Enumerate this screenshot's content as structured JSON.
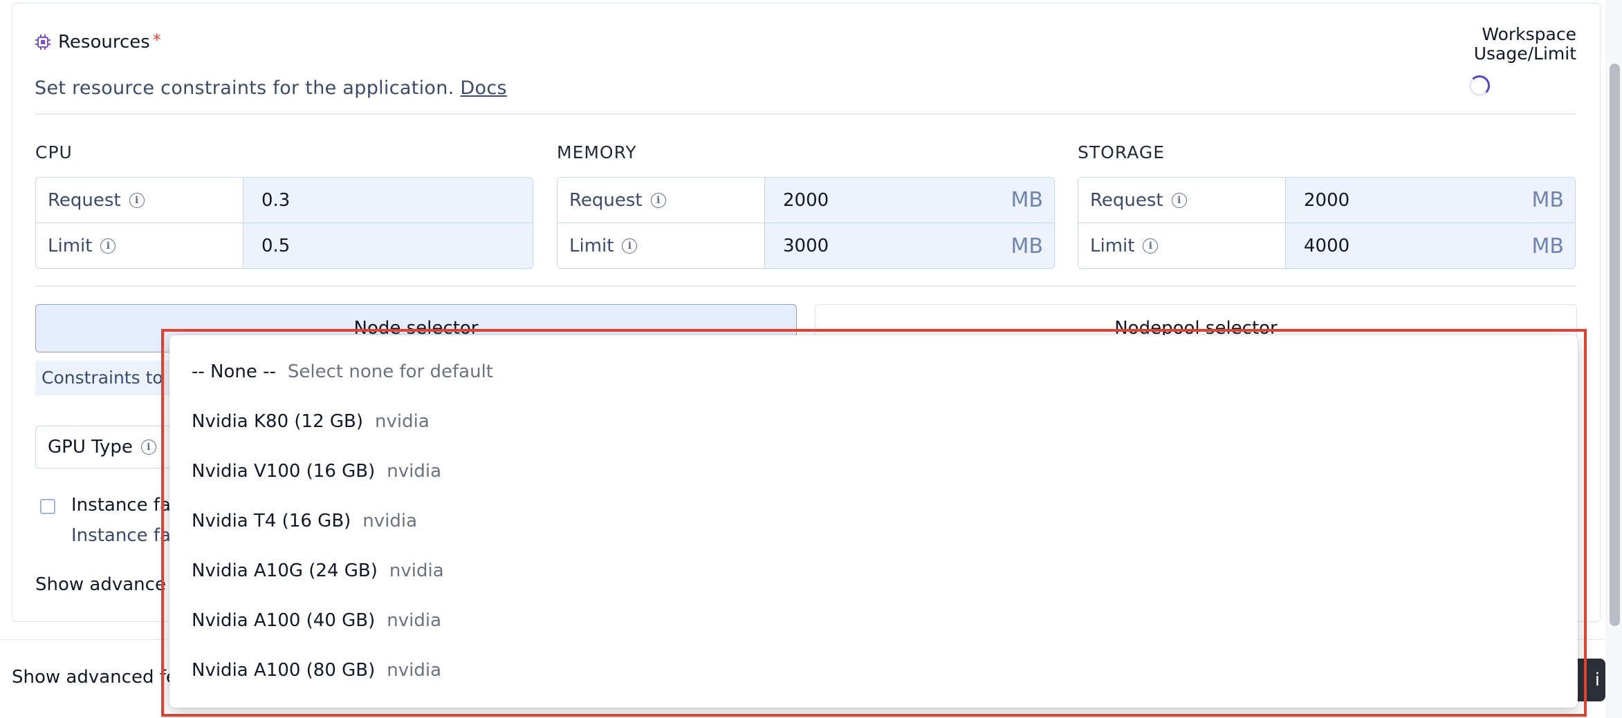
{
  "resources": {
    "title": "Resources",
    "required_mark": "*",
    "description": "Set resource constraints for the application.",
    "docs_link": "Docs",
    "usage_line1": "Workspace",
    "usage_line2": "Usage/Limit"
  },
  "cpu": {
    "label": "CPU",
    "request_label": "Request",
    "request_value": "0.3",
    "limit_label": "Limit",
    "limit_value": "0.5"
  },
  "memory": {
    "label": "MEMORY",
    "request_label": "Request",
    "request_value": "2000",
    "limit_label": "Limit",
    "limit_value": "3000",
    "unit": "MB"
  },
  "storage": {
    "label": "STORAGE",
    "request_label": "Request",
    "request_value": "2000",
    "limit_label": "Limit",
    "limit_value": "4000",
    "unit": "MB"
  },
  "selectors": {
    "node": "Node selector",
    "nodepool": "Nodepool selector"
  },
  "constraints_text": "Constraints to",
  "gpu": {
    "label": "GPU Type"
  },
  "instance": {
    "title": "Instance fa",
    "subtitle": "Instance fa"
  },
  "show_advanced_inner": "Show advance",
  "show_advanced_footer": "Show advanced fe",
  "footer_button": "i",
  "dropdown": {
    "options": [
      {
        "label": "-- None --",
        "sub": "Select none for default"
      },
      {
        "label": "Nvidia K80 (12 GB)",
        "sub": "nvidia"
      },
      {
        "label": "Nvidia V100 (16 GB)",
        "sub": "nvidia"
      },
      {
        "label": "Nvidia T4 (16 GB)",
        "sub": "nvidia"
      },
      {
        "label": "Nvidia A10G (24 GB)",
        "sub": "nvidia"
      },
      {
        "label": "Nvidia A100 (40 GB)",
        "sub": "nvidia"
      },
      {
        "label": "Nvidia A100 (80 GB)",
        "sub": "nvidia"
      }
    ]
  },
  "colors": {
    "highlight": "#e2412f",
    "accent": "#5b3fd6",
    "input_bg": "#edf3fd"
  }
}
